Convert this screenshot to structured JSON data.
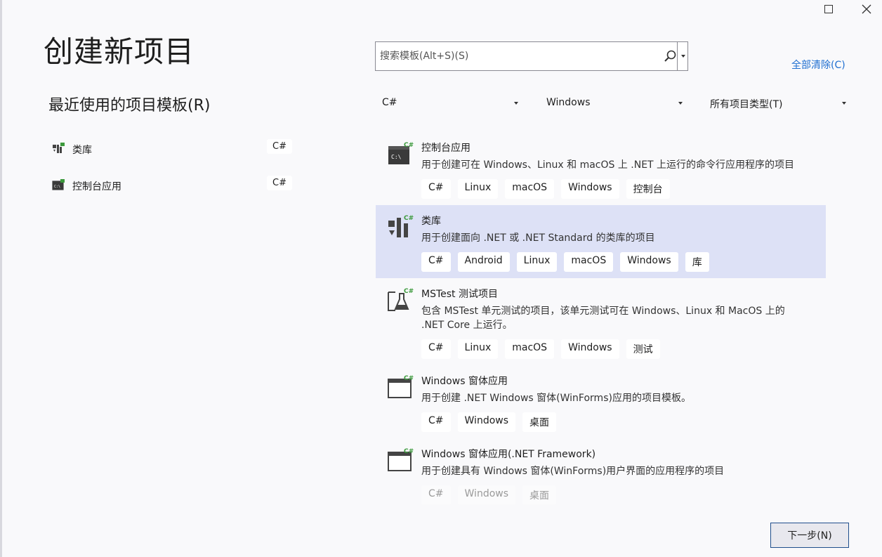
{
  "window": {
    "title": "创建新项目",
    "maximize_icon": "maximize-icon",
    "close_icon": "close-icon"
  },
  "recent": {
    "heading": "最近使用的项目模板(R)",
    "items": [
      {
        "label": "类库",
        "tag": "C#",
        "icon": "class-library-icon"
      },
      {
        "label": "控制台应用",
        "tag": "C#",
        "icon": "console-app-icon"
      }
    ]
  },
  "search": {
    "placeholder": "搜索模板(Alt+S)(S)",
    "value": "",
    "icon": "search-icon"
  },
  "clear_all": "全部清除(C)",
  "filters": {
    "language": "C#",
    "platform": "Windows",
    "project_type": "所有项目类型(T)"
  },
  "templates": [
    {
      "name": "控制台应用",
      "description": "用于创建可在 Windows、Linux 和 macOS 上 .NET 上运行的命令行应用程序的项目",
      "tags": [
        "C#",
        "Linux",
        "macOS",
        "Windows",
        "控制台"
      ],
      "icon": "console-app-icon"
    },
    {
      "name": "类库",
      "description": "用于创建面向 .NET 或 .NET Standard 的类库的项目",
      "tags": [
        "C#",
        "Android",
        "Linux",
        "macOS",
        "Windows",
        "库"
      ],
      "icon": "class-library-icon",
      "selected": true
    },
    {
      "name": "MSTest 测试项目",
      "description": "包含 MSTest 单元测试的项目，该单元测试可在 Windows、Linux 和 MacOS 上的 .NET Core 上运行。",
      "tags": [
        "C#",
        "Linux",
        "macOS",
        "Windows",
        "测试"
      ],
      "icon": "test-project-icon"
    },
    {
      "name": "Windows 窗体应用",
      "description": "用于创建 .NET Windows 窗体(WinForms)应用的项目模板。",
      "tags": [
        "C#",
        "Windows",
        "桌面"
      ],
      "icon": "winforms-app-icon"
    },
    {
      "name": "Windows 窗体应用(.NET Framework)",
      "description": "用于创建具有 Windows 窗体(WinForms)用户界面的应用程序的项目",
      "tags": [
        "C#",
        "Windows",
        "桌面"
      ],
      "icon": "winforms-app-icon"
    }
  ],
  "next_button": "下一步(N)",
  "colors": {
    "background": "#f9f9fb",
    "selected_row": "#dde1f6",
    "link": "#1f6fd1",
    "csharp_badge": "#3c9a3c"
  }
}
